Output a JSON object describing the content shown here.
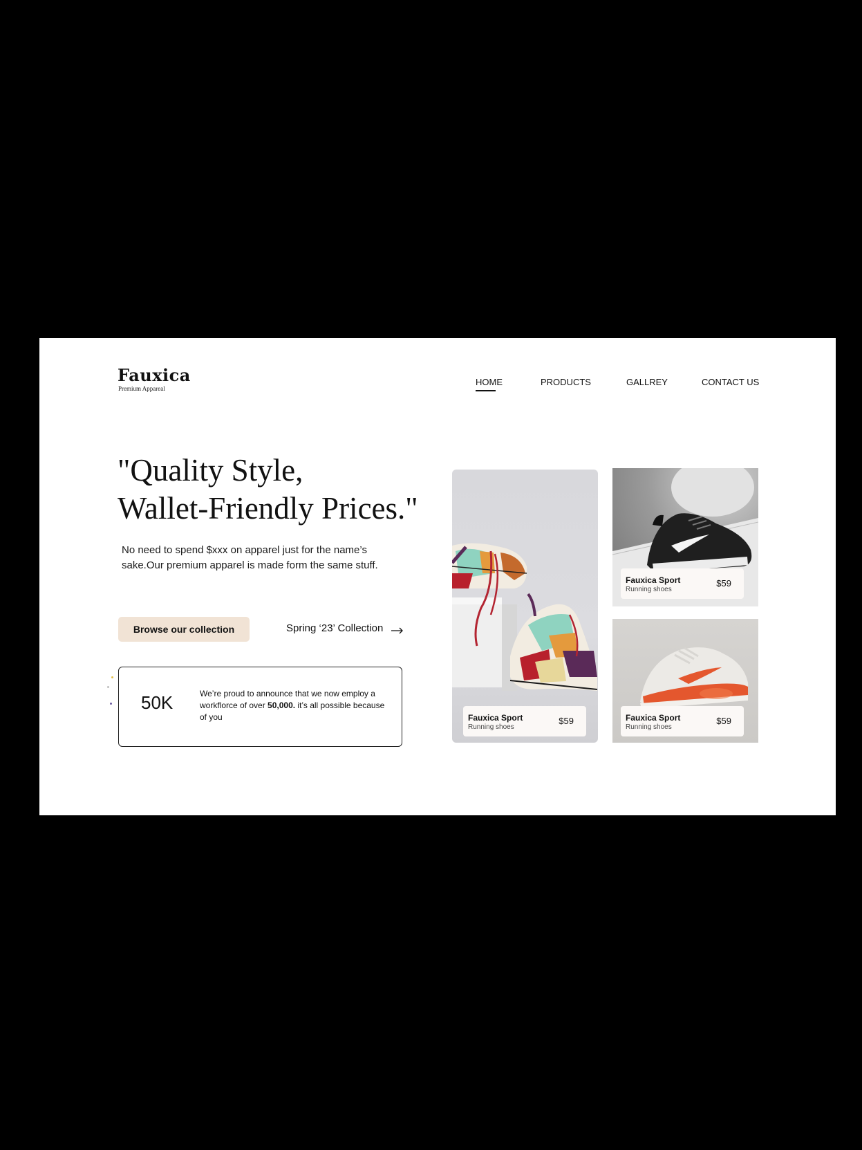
{
  "brand": {
    "name": "Fauxica",
    "tagline": "Premium Appareal"
  },
  "nav": {
    "items": [
      {
        "label": "HOME",
        "active": true
      },
      {
        "label": "PRODUCTS",
        "active": false
      },
      {
        "label": "GALLREY",
        "active": false
      },
      {
        "label": "CONTACT US",
        "active": false
      }
    ]
  },
  "hero": {
    "headline_line1": "\"Quality Style,",
    "headline_line2": "Wallet-Friendly Prices.\"",
    "intro": "No need to spend $xxx on apparel just for the name’s sake.Our premium apparel is made form the same stuff.",
    "cta_label": "Browse our collection",
    "secondary_link": "Spring ‘23’ Collection"
  },
  "stat": {
    "number": "50K",
    "text_before": "We’re proud to announce that we now employ a workflorce of over ",
    "text_bold": "50,000.",
    "text_after": " it’s all possible because of you"
  },
  "products": [
    {
      "brand": "Fauxica Sport",
      "type": "Running shoes",
      "price": "$59"
    },
    {
      "brand": "Fauxica Sport",
      "type": "Running shoes",
      "price": "$59"
    },
    {
      "brand": "Fauxica Sport",
      "type": "Running shoes",
      "price": "$59"
    }
  ],
  "colors": {
    "cta_bg": "#f1e3d5",
    "card_bg": "#fbf8f6",
    "outer_bg": "#000000",
    "page_bg": "#ffffff"
  }
}
